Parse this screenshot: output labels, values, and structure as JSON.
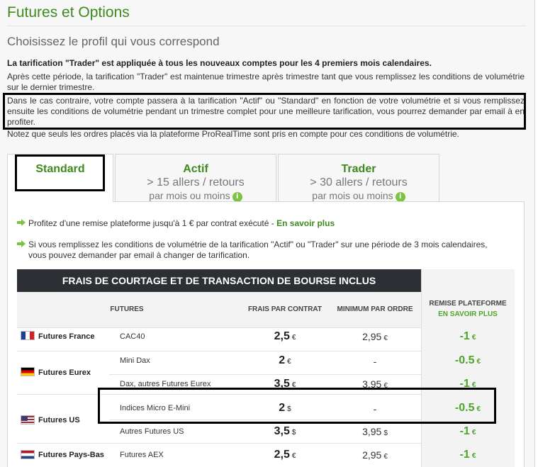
{
  "header": {
    "title": "Futures et Options",
    "subtitle": "Choisissez le profil qui vous correspond"
  },
  "intro": {
    "p1": "La tarification \"Trader\" est appliquée à tous les nouveaux comptes pour les 4 premiers mois calendaires.",
    "p2": "Après cette période, la tarification \"Trader\" est maintenue trimestre après trimestre tant que vous remplissez les conditions de volumétrie sur le dernier trimestre.",
    "p3": "Dans le cas contraire, votre compte passera à la tarification \"Actif\" ou \"Standard\" en fonction de votre volumétrie et si vous remplissez ensuite les conditions de volumétrie pendant un trimestre complet pour une meilleure tarification, vous pourrez demander par email à en profiter.",
    "p4": "Notez que seuls les ordres placés via la plateforme ProRealTime sont pris en compte pour ces conditions de volumétrie."
  },
  "tabs": [
    {
      "title": "Standard",
      "line1": "",
      "line2": ""
    },
    {
      "title": "Actif",
      "line1": "> 15 allers / retours",
      "line2": "par mois ou moins"
    },
    {
      "title": "Trader",
      "line1": "> 30 allers / retours",
      "line2": "par mois ou moins"
    }
  ],
  "bullets": {
    "b1_text": "Profitez d'une remise plateforme jusqu'à 1 € par contrat exécuté - ",
    "b1_link": "En savoir plus",
    "b2_line1": "Si vous remplissez les conditions de volumétrie de la tarification \"Actif\" ou \"Trader\" sur une période de 3 mois calendaires,",
    "b2_line2": "vous pouvez demander par email à changer de tarification."
  },
  "table": {
    "heading": "FRAIS DE COURTAGE ET DE TRANSACTION DE BOURSE INCLUS",
    "col_futures": "FUTURES",
    "col_frais": "FRAIS PAR CONTRAT",
    "col_minimum": "MINIMUM PAR ORDRE",
    "col_remise": "REMISE PLATEFORME",
    "col_remise_link": "EN SAVOIR PLUS",
    "groups": {
      "france": "Futures France",
      "eurex": "Futures Eurex",
      "us": "Futures US",
      "paysbas": "Futures Pays-Bas"
    },
    "rows": [
      {
        "contract": "CAC40",
        "fee": "2,5",
        "fee_cur": "€",
        "min": "2,95",
        "min_cur": "€",
        "remise": "-1",
        "remise_cur": "€"
      },
      {
        "contract": "Mini Dax",
        "fee": "2",
        "fee_cur": "€",
        "min": "-",
        "min_cur": "",
        "remise": "-0.5",
        "remise_cur": "€"
      },
      {
        "contract": "Dax, autres Futures Eurex",
        "fee": "3,5",
        "fee_cur": "€",
        "min": "3,95",
        "min_cur": "€",
        "remise": "-1",
        "remise_cur": "€"
      },
      {
        "contract": "Indices Micro E-Mini",
        "fee": "2",
        "fee_cur": "$",
        "min": "-",
        "min_cur": "",
        "remise": "-0.5",
        "remise_cur": "€"
      },
      {
        "contract": "Autres Futures US",
        "fee": "3,5",
        "fee_cur": "$",
        "min": "3,95",
        "min_cur": "$",
        "remise": "-1",
        "remise_cur": "€"
      },
      {
        "contract": "Futures AEX",
        "fee": "2,5",
        "fee_cur": "€",
        "min": "2,95",
        "min_cur": "€",
        "remise": "-1",
        "remise_cur": "€"
      }
    ]
  },
  "icons": {
    "info": "info-icon",
    "arrow": "green-arrow-icon"
  },
  "colors": {
    "accent": "#3d8b1f",
    "remise": "#4da52a",
    "header_bg": "#2c2f33"
  }
}
